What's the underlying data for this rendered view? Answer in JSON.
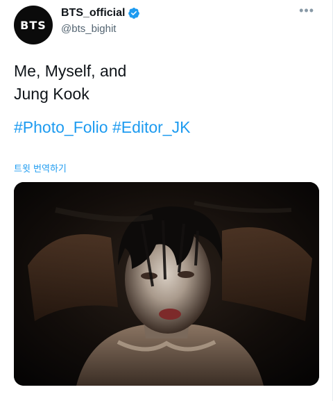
{
  "user": {
    "avatar_text": "BTS",
    "display_name": "BTS_official",
    "handle": "@bts_bighit",
    "verified": true
  },
  "menu": {
    "more_icon": "more-horizontal-icon",
    "more_glyph": "•••"
  },
  "tweet": {
    "lines": [
      "Me, Myself, and",
      "Jung Kook"
    ],
    "hashtags": [
      "#Photo_Folio",
      "#Editor_JK"
    ],
    "translate_label": "트윗 번역하기"
  },
  "colors": {
    "link": "#1d9bf0",
    "text": "#0f1419",
    "secondary": "#536471",
    "verified_badge": "#1d9bf0"
  }
}
